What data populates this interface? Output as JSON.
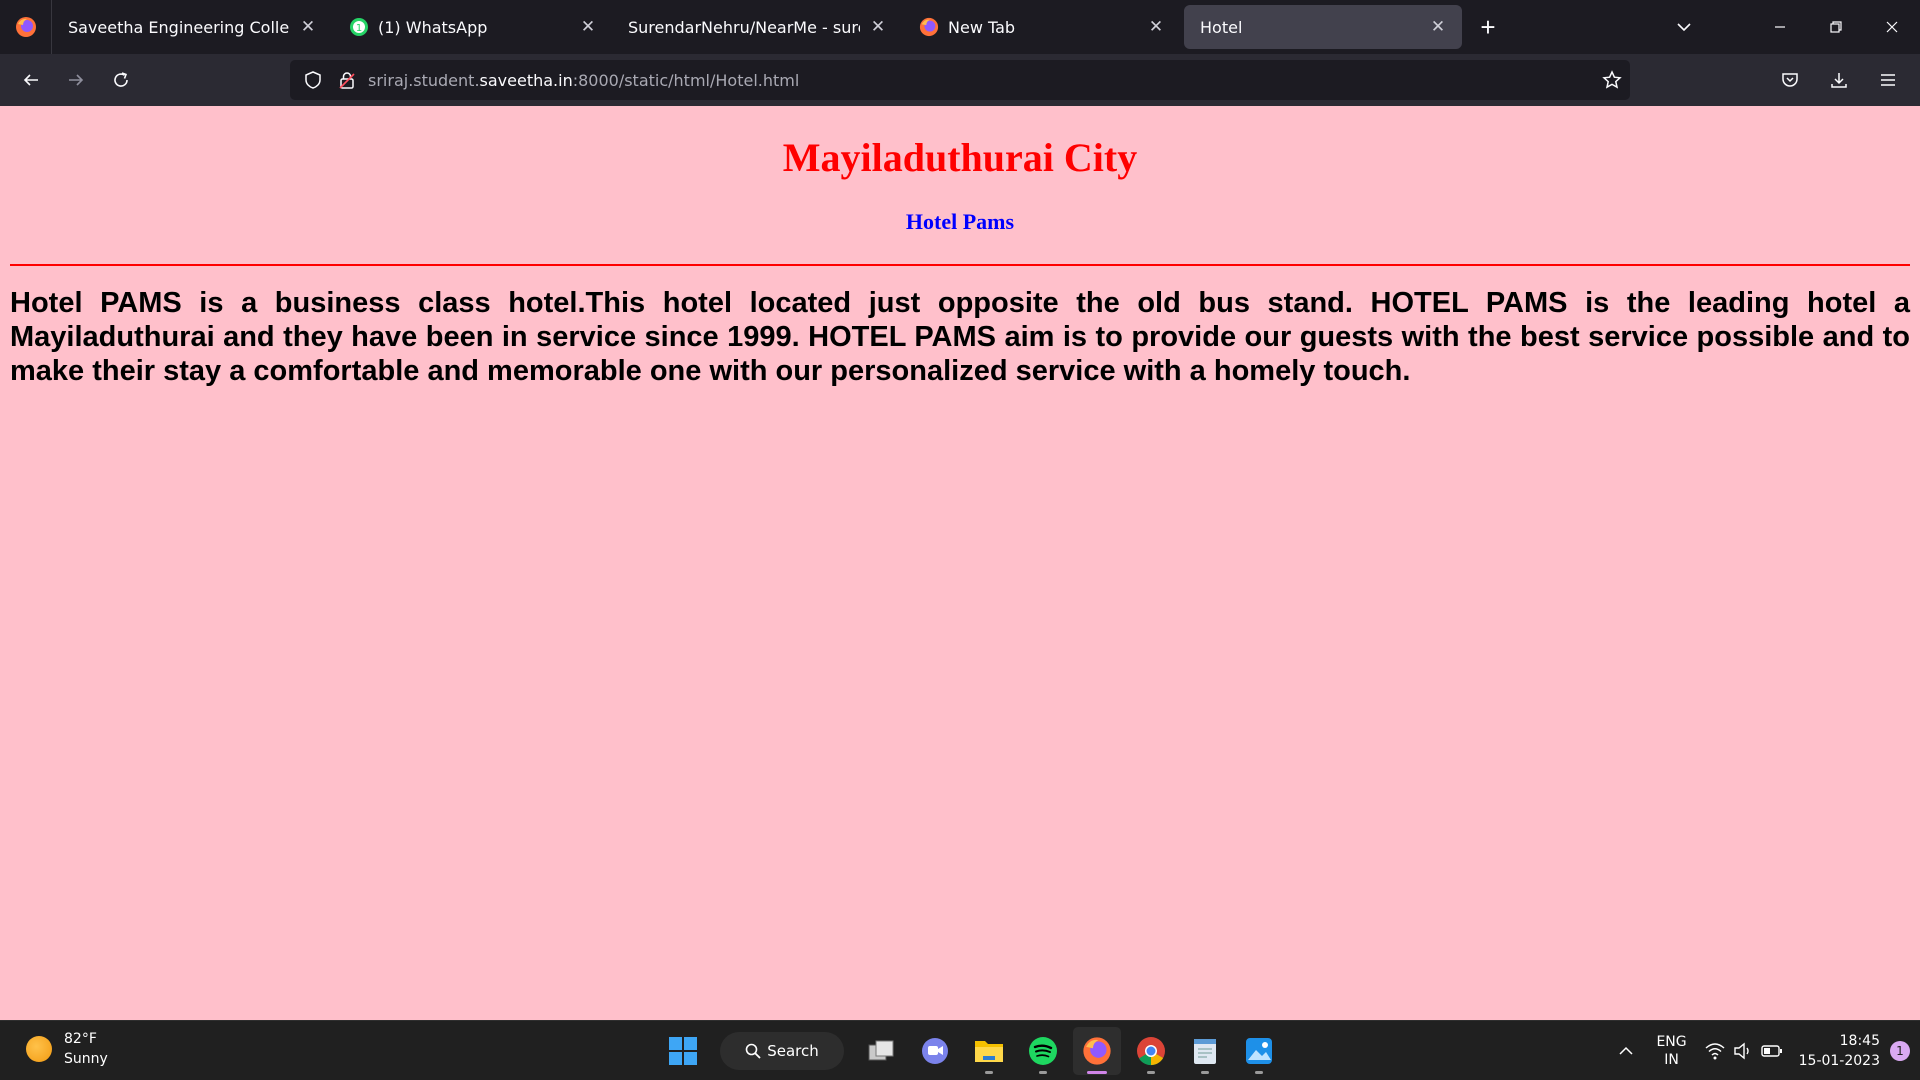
{
  "browser": {
    "tabs": [
      {
        "title": "Saveetha Engineering College",
        "icon": "firefox-blank-icon"
      },
      {
        "title": "(1) WhatsApp",
        "icon": "whatsapp-icon"
      },
      {
        "title": "SurendarNehru/NearMe - surendar",
        "icon": "github-icon"
      },
      {
        "title": "New Tab",
        "icon": "firefox-icon"
      },
      {
        "title": "Hotel",
        "icon": "none",
        "active": true
      }
    ],
    "new_tab_label": "+",
    "url": {
      "prefix": "sriraj.student.",
      "host": "saveetha.in",
      "rest": ":8000/static/html/Hotel.html"
    }
  },
  "page": {
    "title": "Mayiladuthurai City",
    "subtitle": "Hotel Pams",
    "body": "Hotel PAMS is a business class hotel.This hotel located just opposite the old bus stand. HOTEL PAMS is the leading hotel a Mayiladuthurai and they have been in service since 1999. HOTEL PAMS aim is to provide our guests with the best service possible and to make their stay a comfortable and memorable one with our personalized service with a homely touch.",
    "colors": {
      "background": "#ffc0cb",
      "title": "#ff0000",
      "subtitle": "#0000ff",
      "rule": "#ff0000"
    }
  },
  "taskbar": {
    "weather": {
      "temp": "82°F",
      "condition": "Sunny"
    },
    "search_label": "Search",
    "lang": {
      "line1": "ENG",
      "line2": "IN"
    },
    "clock": {
      "time": "18:45",
      "date": "15-01-2023"
    },
    "notification_count": "1"
  }
}
